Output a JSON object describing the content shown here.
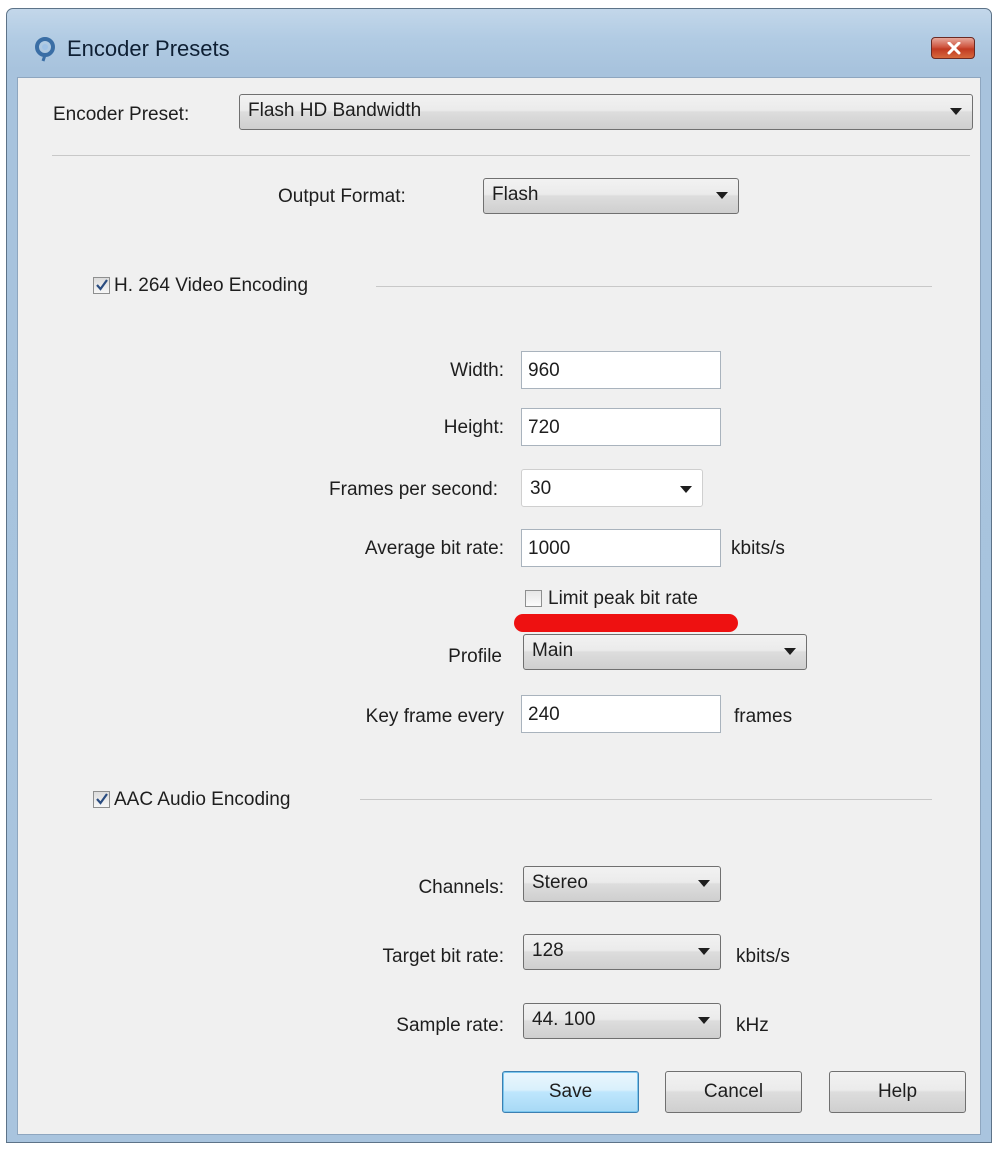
{
  "window": {
    "title": "Encoder Presets",
    "icon": "app-swirl-icon",
    "close_icon": "close-x-icon"
  },
  "preset": {
    "label": "Encoder Preset:",
    "value": "Flash HD Bandwidth"
  },
  "output_format": {
    "label": "Output Format:",
    "value": "Flash"
  },
  "video": {
    "checkbox_label": "H. 264 Video Encoding",
    "checked": true,
    "width_label": "Width:",
    "width_value": "960",
    "height_label": "Height:",
    "height_value": "720",
    "fps_label": "Frames per second:",
    "fps_value": "30",
    "avg_bitrate_label": "Average bit rate:",
    "avg_bitrate_value": "1000",
    "avg_bitrate_unit": "kbits/s",
    "limit_peak_label": "Limit peak bit rate",
    "limit_peak_checked": false,
    "profile_label": "Profile",
    "profile_value": "Main",
    "keyframe_label": "Key frame every",
    "keyframe_value": "240",
    "keyframe_unit": "frames"
  },
  "audio": {
    "checkbox_label": "AAC Audio Encoding",
    "checked": true,
    "channels_label": "Channels:",
    "channels_value": "Stereo",
    "target_bitrate_label": "Target bit rate:",
    "target_bitrate_value": "128",
    "target_bitrate_unit": "kbits/s",
    "sample_rate_label": "Sample rate:",
    "sample_rate_value": "44. 100",
    "sample_rate_unit": "kHz"
  },
  "buttons": {
    "save": "Save",
    "cancel": "Cancel",
    "help": "Help"
  },
  "colors": {
    "annotation": "#ee1111",
    "title_bar": "#b1cbe3",
    "close_button": "#c13a22"
  }
}
